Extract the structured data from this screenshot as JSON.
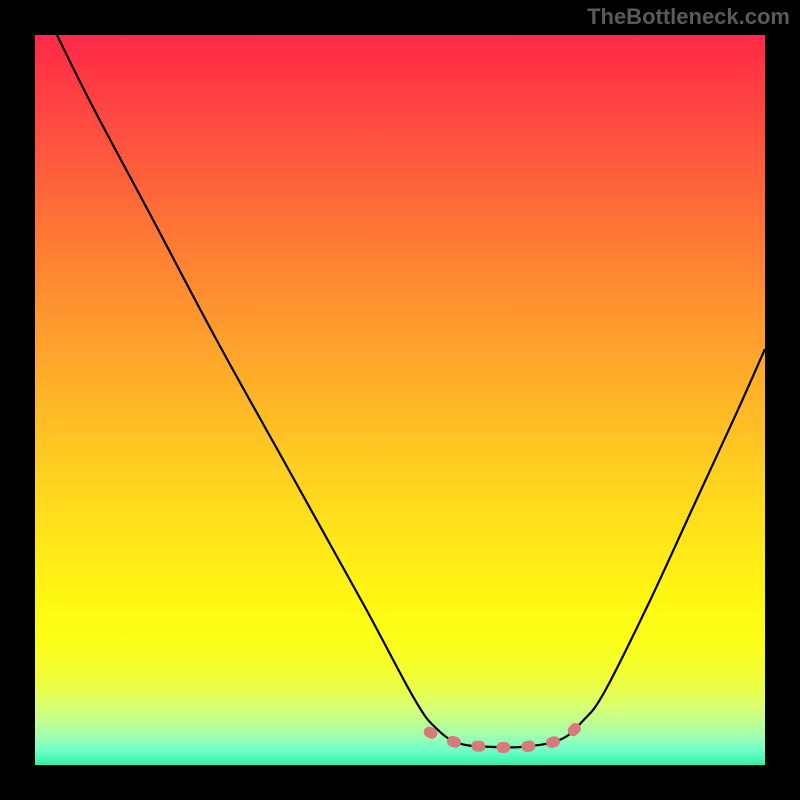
{
  "watermark": "TheBottleneck.com",
  "chart_data": {
    "type": "line",
    "title": "",
    "xlabel": "",
    "ylabel": "",
    "xlim": [
      0,
      100
    ],
    "ylim": [
      0,
      100
    ],
    "gradient_stops": [
      {
        "pct": 0,
        "color": "#ff2a48"
      },
      {
        "pct": 14,
        "color": "#ff5040"
      },
      {
        "pct": 36,
        "color": "#ff9030"
      },
      {
        "pct": 60,
        "color": "#ffd020"
      },
      {
        "pct": 78,
        "color": "#fff812"
      },
      {
        "pct": 90,
        "color": "#e8ff50"
      },
      {
        "pct": 96,
        "color": "#a0ffb0"
      },
      {
        "pct": 100,
        "color": "#30f0a0"
      }
    ],
    "series": [
      {
        "name": "bottleneck-curve",
        "stroke": "#000000",
        "points": [
          {
            "x": 3,
            "y": 100
          },
          {
            "x": 8,
            "y": 90
          },
          {
            "x": 16,
            "y": 75
          },
          {
            "x": 25,
            "y": 58
          },
          {
            "x": 35,
            "y": 40
          },
          {
            "x": 45,
            "y": 22
          },
          {
            "x": 52,
            "y": 9
          },
          {
            "x": 55,
            "y": 5
          },
          {
            "x": 58,
            "y": 3
          },
          {
            "x": 62,
            "y": 2.5
          },
          {
            "x": 67,
            "y": 2.5
          },
          {
            "x": 72,
            "y": 3.5
          },
          {
            "x": 75,
            "y": 6
          },
          {
            "x": 78,
            "y": 10
          },
          {
            "x": 84,
            "y": 22
          },
          {
            "x": 90,
            "y": 35
          },
          {
            "x": 96,
            "y": 48
          },
          {
            "x": 100,
            "y": 57
          }
        ]
      },
      {
        "name": "flat-highlight",
        "stroke": "#d97a7a",
        "points": [
          {
            "x": 54,
            "y": 4.5
          },
          {
            "x": 58,
            "y": 3
          },
          {
            "x": 62,
            "y": 2.5
          },
          {
            "x": 67,
            "y": 2.5
          },
          {
            "x": 72,
            "y": 3.5
          },
          {
            "x": 75,
            "y": 6
          }
        ]
      }
    ]
  }
}
